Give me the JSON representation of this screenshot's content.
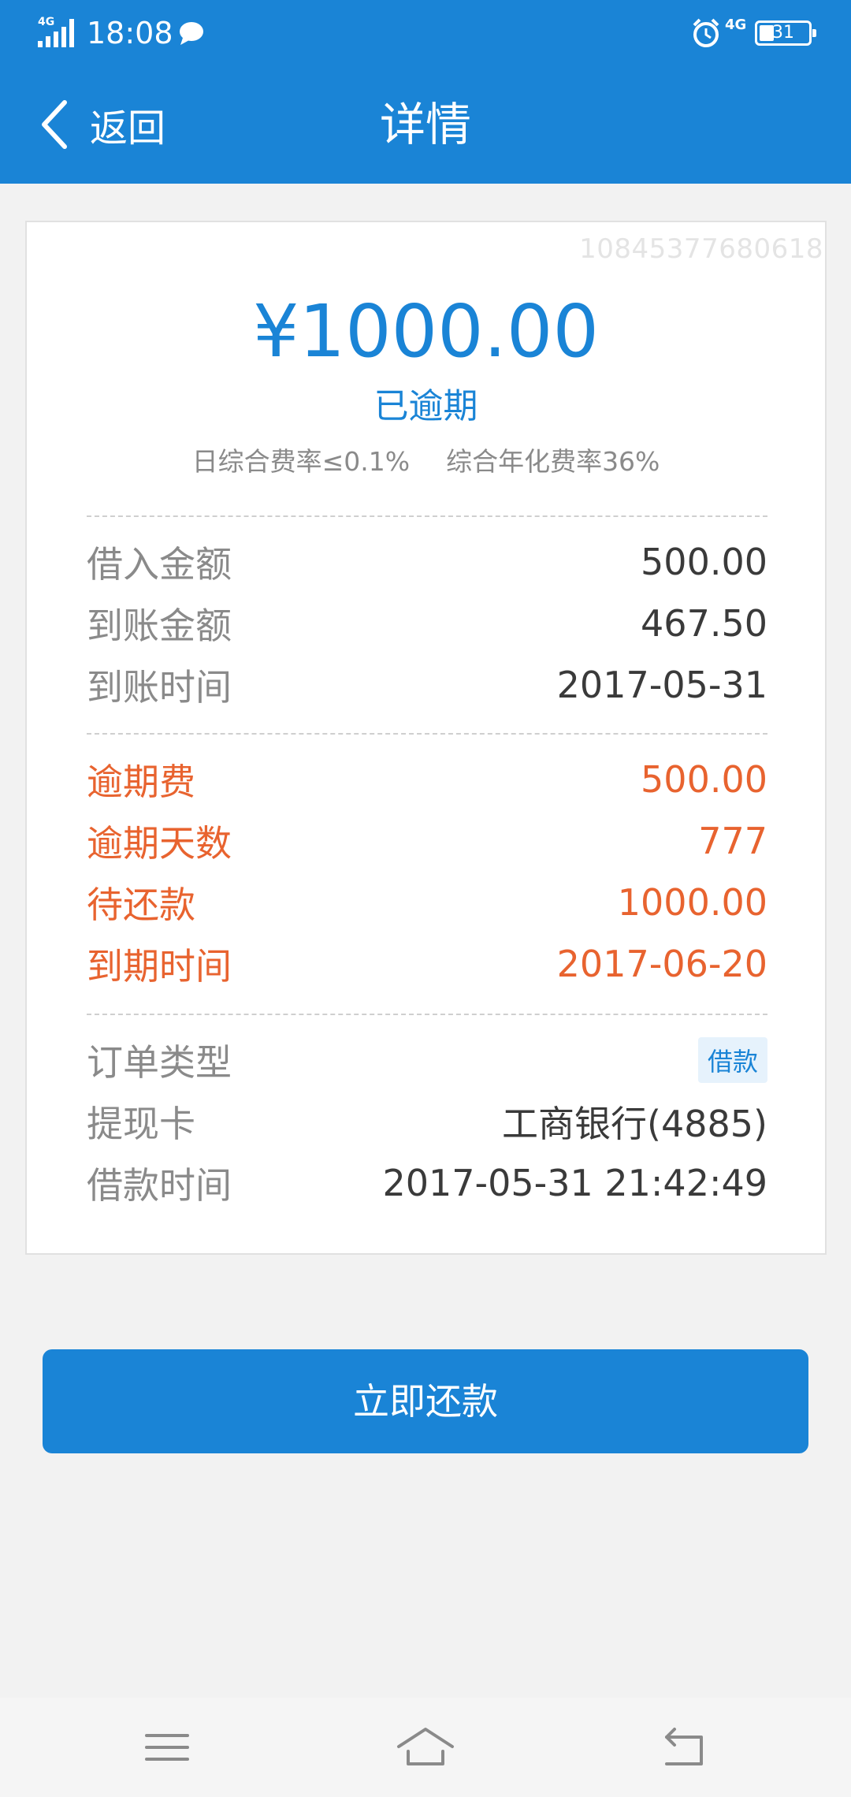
{
  "status_bar": {
    "network_label": "4G",
    "time": "18:08",
    "battery_level": "31",
    "icons": [
      "signal-icon",
      "message-icon",
      "alarm-icon",
      "battery-icon"
    ]
  },
  "header": {
    "back_label": "返回",
    "title": "详情"
  },
  "card": {
    "order_id": "108453776806​18",
    "amount": "¥1000.00",
    "status": "已逾期",
    "rate_daily": "日综合费率≤0.1%",
    "rate_annual": "综合年化费率36%",
    "section1": [
      {
        "label": "借入金额",
        "value": "500.00"
      },
      {
        "label": "到账金额",
        "value": "467.50"
      },
      {
        "label": "到账时间",
        "value": "2017-05-31"
      }
    ],
    "section2": [
      {
        "label": "逾期费",
        "value": "500.00"
      },
      {
        "label": "逾期天数",
        "value": "777"
      },
      {
        "label": "待还款",
        "value": "1000.00"
      },
      {
        "label": "到期时间",
        "value": "2017-06-20"
      }
    ],
    "section3": {
      "order_type_label": "订单类型",
      "order_type_tag": "借款",
      "card_label": "提现卡",
      "card_value": "工商银行(4885)",
      "loan_time_label": "借款时间",
      "loan_time_value": "2017-05-31 21:42:49"
    }
  },
  "repay_button": "立即还款",
  "colors": {
    "primary": "#1a84d6",
    "overdue": "#e8632f",
    "background": "#f2f2f2"
  }
}
